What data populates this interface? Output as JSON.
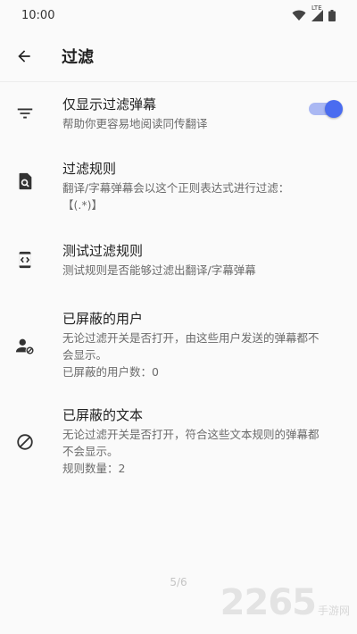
{
  "status_bar": {
    "time": "10:00",
    "network": "LTE"
  },
  "app_bar": {
    "title": "过滤"
  },
  "settings": [
    {
      "title": "仅显示过滤弹幕",
      "lines": [
        "帮助你更容易地阅读同传翻译"
      ],
      "toggle_on": true,
      "icon": "filter-list-icon"
    },
    {
      "title": "过滤规则",
      "lines": [
        "翻译/字幕弹幕会以这个正则表达式进行过滤：",
        "【(.*)】"
      ],
      "icon": "find-in-page-icon"
    },
    {
      "title": "测试过滤规则",
      "lines": [
        "测试规则是否能够过滤出翻译/字幕弹幕"
      ],
      "icon": "code-device-icon"
    },
    {
      "title": "已屏蔽的用户",
      "lines": [
        "无论过滤开关是否打开，由这些用户发送的弹幕都不",
        "会显示。",
        "已屏蔽的用户数：0"
      ],
      "icon": "person-off-icon"
    },
    {
      "title": "已屏蔽的文本",
      "lines": [
        "无论过滤开关是否打开，符合这些文本规则的弹幕都",
        "不会显示。",
        "规则数量：2"
      ],
      "icon": "block-icon"
    }
  ],
  "page_indicator": "5/6",
  "watermark": {
    "number": "2265",
    "text": "手游网"
  },
  "colors": {
    "accent": "#4a6cf0",
    "accent_track": "#aab8f3"
  }
}
